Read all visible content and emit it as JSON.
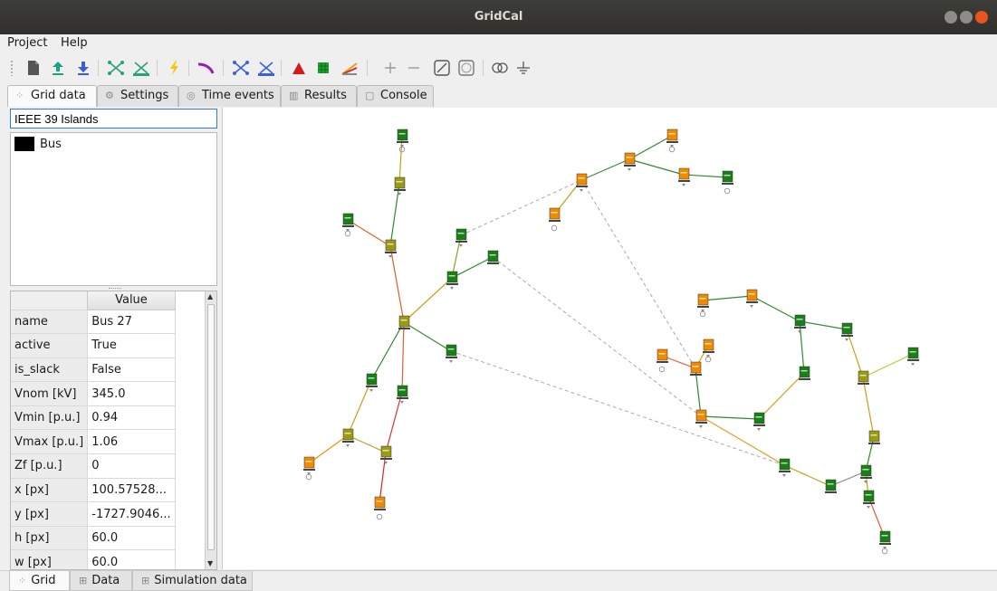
{
  "window": {
    "title": "GridCal"
  },
  "menu": [
    "Project",
    "Help"
  ],
  "toolbar_icons": [
    "new-file-icon",
    "upload-icon",
    "download-icon",
    "grid-layout-icon",
    "grid-layout-alt-icon",
    "power-flow-icon",
    "curve-icon",
    "network-icon",
    "network-alt-icon",
    "triangle-chart-icon",
    "matrix-icon",
    "color-gradient-icon",
    "zoom-in-icon",
    "zoom-out-icon",
    "line-tool-icon",
    "map-icon",
    "rings-icon",
    "ground-icon"
  ],
  "tabs": [
    {
      "label": "Grid data",
      "icon": "network-icon",
      "active": true
    },
    {
      "label": "Settings",
      "icon": "gear-icon",
      "active": false
    },
    {
      "label": "Time events",
      "icon": "clock-icon",
      "active": false
    },
    {
      "label": "Results",
      "icon": "results-icon",
      "active": false
    },
    {
      "label": "Console",
      "icon": "console-icon",
      "active": false
    }
  ],
  "search": {
    "value": "IEEE 39 Islands"
  },
  "object_types": [
    {
      "label": "Bus",
      "color": "#000000"
    }
  ],
  "properties": {
    "header": "Value",
    "rows": [
      {
        "key": "name",
        "value": "Bus 27"
      },
      {
        "key": "active",
        "value": "True"
      },
      {
        "key": "is_slack",
        "value": "False"
      },
      {
        "key": "Vnom [kV]",
        "value": "345.0"
      },
      {
        "key": "Vmin [p.u.]",
        "value": "0.94"
      },
      {
        "key": "Vmax [p.u.]",
        "value": "1.06"
      },
      {
        "key": "Zf [p.u.]",
        "value": "0"
      },
      {
        "key": "x [px]",
        "value": "100.57528..."
      },
      {
        "key": "y [px]",
        "value": "-1727.9046..."
      },
      {
        "key": "h [px]",
        "value": "60.0"
      },
      {
        "key": "w [px]",
        "value": "60.0"
      }
    ]
  },
  "bottom_tabs": [
    {
      "label": "Grid",
      "icon": "network-icon",
      "active": true
    },
    {
      "label": "Data",
      "icon": "table-icon",
      "active": false
    },
    {
      "label": "Simulation data",
      "icon": "table-icon",
      "active": false
    }
  ],
  "colors": {
    "bus_green": "#1a7f16",
    "bus_yellow": "#9a9a13",
    "bus_orange": "#f08a00",
    "line_dashed": "#aaaaaa"
  }
}
